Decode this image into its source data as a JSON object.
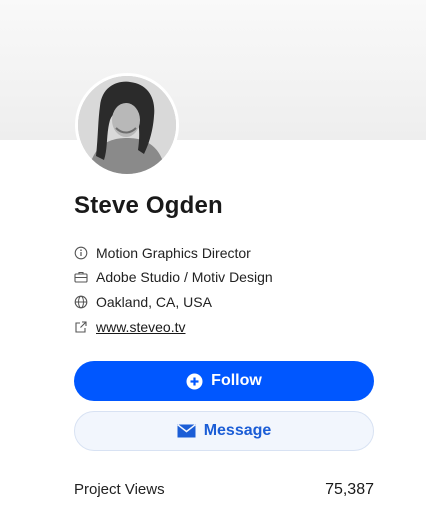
{
  "profile": {
    "name": "Steve Ogden",
    "details": [
      {
        "icon": "info-circle-icon",
        "text": "Motion Graphics Director"
      },
      {
        "icon": "briefcase-icon",
        "text": "Adobe Studio / Motiv Design"
      },
      {
        "icon": "globe-icon",
        "text": "Oakland, CA, USA"
      },
      {
        "icon": "external-link-icon",
        "text": "www.steveo.tv"
      }
    ]
  },
  "actions": {
    "follow_label": "Follow",
    "follow_icon": "plus-circle-icon",
    "message_label": "Message",
    "message_icon": "envelope-icon"
  },
  "stats": {
    "label": "Project Views",
    "value": "75,387"
  },
  "colors": {
    "primary": "#0057ff",
    "message_text": "#1b5dd6",
    "message_bg": "#f2f6fd"
  }
}
